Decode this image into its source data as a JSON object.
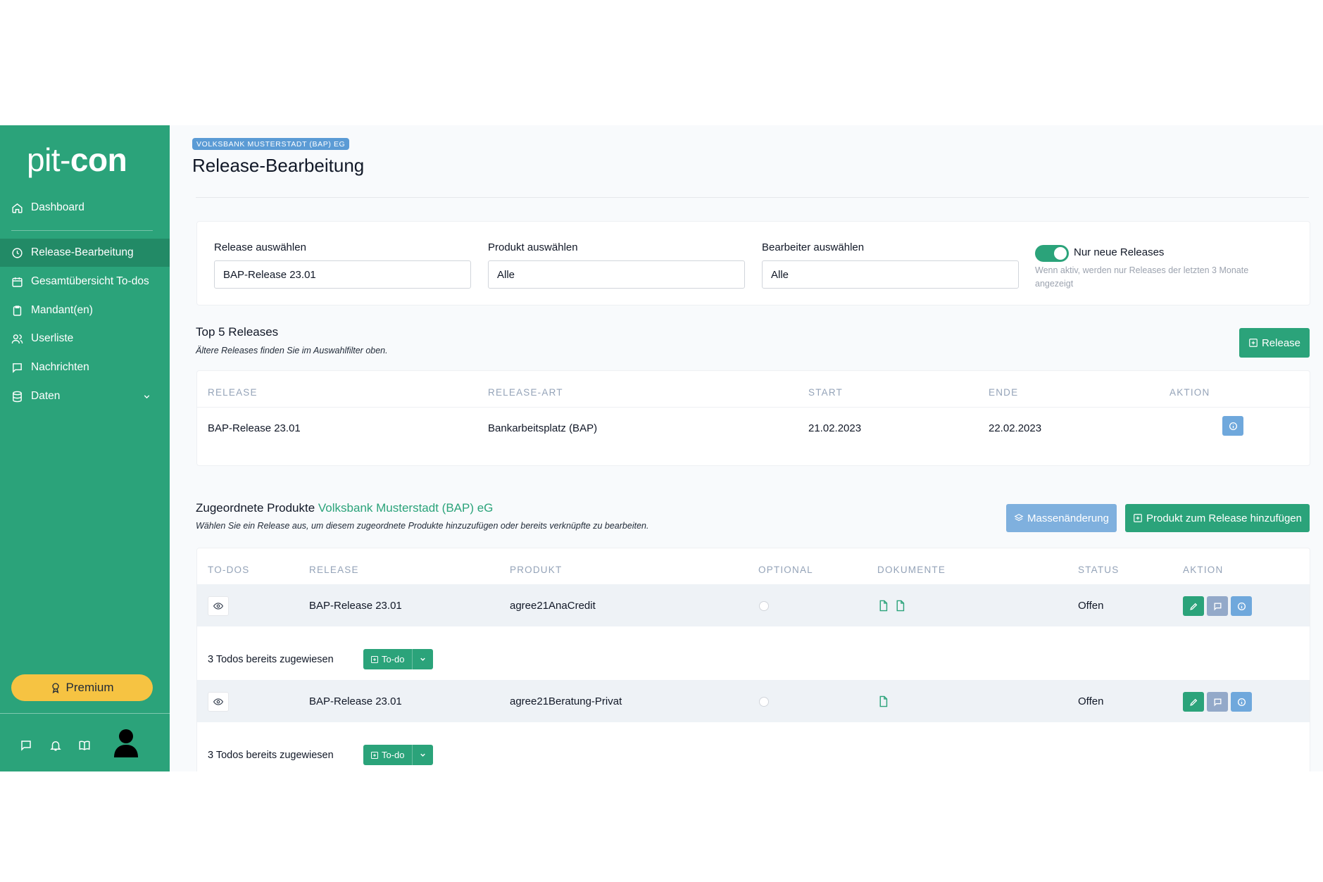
{
  "brand": {
    "logo_light": "pit-",
    "logo_bold": "con"
  },
  "sidebar": {
    "items": [
      {
        "label": "Dashboard",
        "icon": "home-icon"
      },
      {
        "label": "Release-Bearbeitung",
        "icon": "clock-icon",
        "active": true
      },
      {
        "label": "Gesamtübersicht To-dos",
        "icon": "calendar-icon"
      },
      {
        "label": "Mandant(en)",
        "icon": "clipboard-icon"
      },
      {
        "label": "Userliste",
        "icon": "users-icon"
      },
      {
        "label": "Nachrichten",
        "icon": "message-icon"
      },
      {
        "label": "Daten",
        "icon": "database-icon"
      }
    ],
    "premium_label": "Premium",
    "bottom_icons": [
      "chat-icon",
      "bell-icon",
      "book-icon",
      "avatar"
    ]
  },
  "header": {
    "org_badge": "VOLKSBANK MUSTERSTADT (BAP) EG",
    "title": "Release-Bearbeitung"
  },
  "filters": {
    "release": {
      "label": "Release auswählen",
      "value": "BAP-Release 23.01"
    },
    "product": {
      "label": "Produkt auswählen",
      "value": "Alle"
    },
    "editor": {
      "label": "Bearbeiter auswählen",
      "value": "Alle"
    },
    "toggle": {
      "label": "Nur neue Releases",
      "help": "Wenn aktiv, werden nur Releases der letzten 3 Monate angezeigt",
      "on": true
    }
  },
  "top_releases": {
    "title": "Top 5 Releases",
    "subtitle": "Ältere Releases finden Sie im Auswahlfilter oben.",
    "add_button": "Release",
    "columns": [
      "RELEASE",
      "RELEASE-ART",
      "START",
      "ENDE",
      "AKTION"
    ],
    "rows": [
      {
        "release": "BAP-Release 23.01",
        "art": "Bankarbeitsplatz (BAP)",
        "start": "21.02.2023",
        "ende": "22.02.2023"
      }
    ]
  },
  "products": {
    "title": "Zugeordnete Produkte",
    "title_accent": "Volksbank Musterstadt (BAP) eG",
    "subtitle": "Wählen Sie ein Release aus, um diesem zugeordnete Produkte hinzuzufügen oder bereits verknüpfte zu bearbeiten.",
    "mass_button": "Massenänderung",
    "add_button": "Produkt zum Release hinzufügen",
    "columns": [
      "TO-DOS",
      "RELEASE",
      "PRODUKT",
      "OPTIONAL",
      "DOKUMENTE",
      "STATUS",
      "AKTION"
    ],
    "rows": [
      {
        "release": "BAP-Release 23.01",
        "produkt": "agree21AnaCredit",
        "status": "Offen",
        "documents": 2,
        "todos_text": "3 Todos bereits zugewiesen",
        "todo_button": "To-do"
      },
      {
        "release": "BAP-Release 23.01",
        "produkt": "agree21Beratung-Privat",
        "status": "Offen",
        "documents": 1,
        "todos_text": "3 Todos bereits zugewiesen",
        "todo_button": "To-do"
      }
    ]
  },
  "colors": {
    "brand_green": "#2ba37a",
    "sidebar_active": "#228a66",
    "accent_blue": "#5b9bd5",
    "premium_yellow": "#f6c342",
    "muted_blue": "#93b3d6"
  }
}
